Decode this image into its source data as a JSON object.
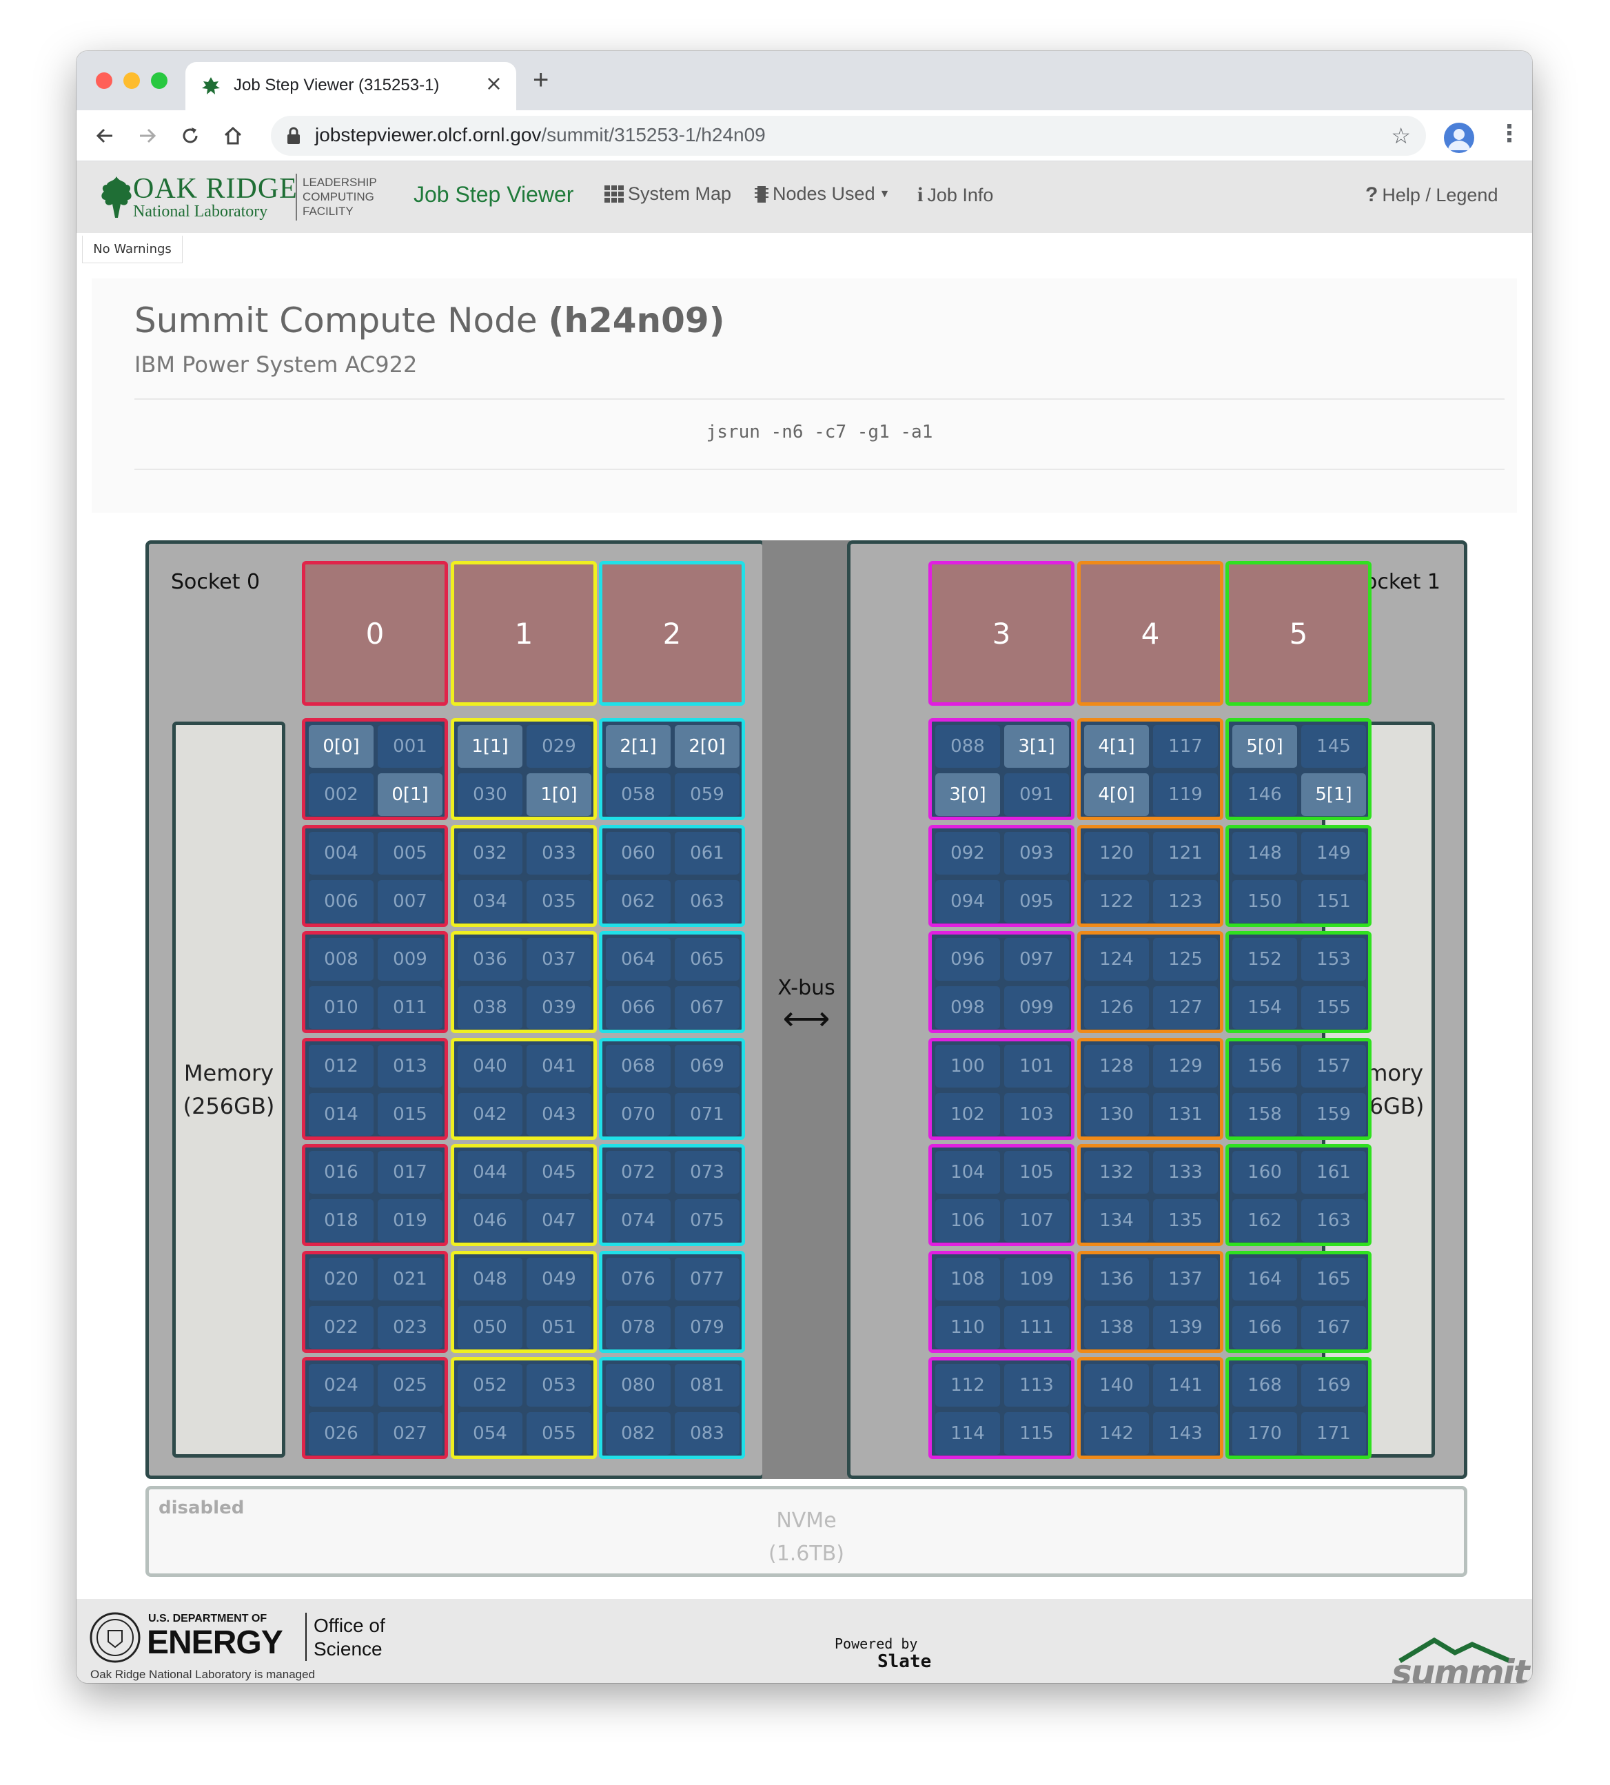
{
  "browser": {
    "tab_title": "Job Step Viewer (315253-1)",
    "url_host": "jobstepviewer.olcf.ornl.gov",
    "url_path": "/summit/315253-1/h24n09"
  },
  "navbar": {
    "logo_line1": "OAK RIDGE",
    "logo_line2": "National Laboratory",
    "logo_side1": "LEADERSHIP",
    "logo_side2": "COMPUTING",
    "logo_side3": "FACILITY",
    "brand": "Job Step Viewer",
    "system_map": "System Map",
    "nodes_used": "Nodes Used",
    "job_info": "Job Info",
    "help": "Help / Legend"
  },
  "warnings": "No Warnings",
  "header": {
    "title_prefix": "Summit Compute Node ",
    "node_name": "(h24n09)",
    "subtitle": "IBM Power System AC922",
    "command": "jsrun -n6 -c7 -g1 -a1"
  },
  "node": {
    "socket0_label": "Socket 0",
    "socket1_label": "Socket 1",
    "memory0_line1": "Memory",
    "memory0_line2": "(256GB)",
    "memory1_line1": "Memory",
    "memory1_line2": "(256GB)",
    "xbus_label": "X-bus",
    "gpus": [
      {
        "label": "0",
        "color": "#e0244a"
      },
      {
        "label": "1",
        "color": "#f0f020"
      },
      {
        "label": "2",
        "color": "#20e0e8"
      },
      {
        "label": "3",
        "color": "#e020e0"
      },
      {
        "label": "4",
        "color": "#f08a18"
      },
      {
        "label": "5",
        "color": "#30e020"
      }
    ],
    "core_columns": [
      {
        "color": "#e0244a",
        "cores": [
          [
            "0[0]",
            "001",
            "002",
            "0[1]"
          ],
          [
            "004",
            "005",
            "006",
            "007"
          ],
          [
            "008",
            "009",
            "010",
            "011"
          ],
          [
            "012",
            "013",
            "014",
            "015"
          ],
          [
            "016",
            "017",
            "018",
            "019"
          ],
          [
            "020",
            "021",
            "022",
            "023"
          ],
          [
            "024",
            "025",
            "026",
            "027"
          ]
        ],
        "used": [
          [
            0,
            3
          ]
        ]
      },
      {
        "color": "#f0f020",
        "cores": [
          [
            "1[1]",
            "029",
            "030",
            "1[0]"
          ],
          [
            "032",
            "033",
            "034",
            "035"
          ],
          [
            "036",
            "037",
            "038",
            "039"
          ],
          [
            "040",
            "041",
            "042",
            "043"
          ],
          [
            "044",
            "045",
            "046",
            "047"
          ],
          [
            "048",
            "049",
            "050",
            "051"
          ],
          [
            "052",
            "053",
            "054",
            "055"
          ]
        ],
        "used": [
          [
            0,
            3
          ]
        ]
      },
      {
        "color": "#20e0e8",
        "cores": [
          [
            "2[1]",
            "2[0]",
            "058",
            "059"
          ],
          [
            "060",
            "061",
            "062",
            "063"
          ],
          [
            "064",
            "065",
            "066",
            "067"
          ],
          [
            "068",
            "069",
            "070",
            "071"
          ],
          [
            "072",
            "073",
            "074",
            "075"
          ],
          [
            "076",
            "077",
            "078",
            "079"
          ],
          [
            "080",
            "081",
            "082",
            "083"
          ]
        ],
        "used": [
          [
            0,
            1
          ]
        ]
      },
      {
        "color": "#e020e0",
        "cores": [
          [
            "088",
            "3[1]",
            "3[0]",
            "091"
          ],
          [
            "092",
            "093",
            "094",
            "095"
          ],
          [
            "096",
            "097",
            "098",
            "099"
          ],
          [
            "100",
            "101",
            "102",
            "103"
          ],
          [
            "104",
            "105",
            "106",
            "107"
          ],
          [
            "108",
            "109",
            "110",
            "111"
          ],
          [
            "112",
            "113",
            "114",
            "115"
          ]
        ],
        "used": [
          [
            1,
            2
          ]
        ]
      },
      {
        "color": "#f08a18",
        "cores": [
          [
            "4[1]",
            "117",
            "4[0]",
            "119"
          ],
          [
            "120",
            "121",
            "122",
            "123"
          ],
          [
            "124",
            "125",
            "126",
            "127"
          ],
          [
            "128",
            "129",
            "130",
            "131"
          ],
          [
            "132",
            "133",
            "134",
            "135"
          ],
          [
            "136",
            "137",
            "138",
            "139"
          ],
          [
            "140",
            "141",
            "142",
            "143"
          ]
        ],
        "used": [
          [
            0,
            2
          ]
        ]
      },
      {
        "color": "#30e020",
        "cores": [
          [
            "5[0]",
            "145",
            "146",
            "5[1]"
          ],
          [
            "148",
            "149",
            "150",
            "151"
          ],
          [
            "152",
            "153",
            "154",
            "155"
          ],
          [
            "156",
            "157",
            "158",
            "159"
          ],
          [
            "160",
            "161",
            "162",
            "163"
          ],
          [
            "164",
            "165",
            "166",
            "167"
          ],
          [
            "168",
            "169",
            "170",
            "171"
          ]
        ],
        "used": [
          [
            0,
            3
          ]
        ]
      }
    ],
    "nvme_status": "disabled",
    "nvme_line1": "NVMe",
    "nvme_line2": "(1.6TB)"
  },
  "footer": {
    "doe_small": "U.S. DEPARTMENT OF",
    "doe_big": "ENERGY",
    "office1": "Office of",
    "office2": "Science",
    "managed": "Oak Ridge National Laboratory is managed",
    "powered_by": "Powered by",
    "slate": "Slate",
    "summit": "summit"
  }
}
